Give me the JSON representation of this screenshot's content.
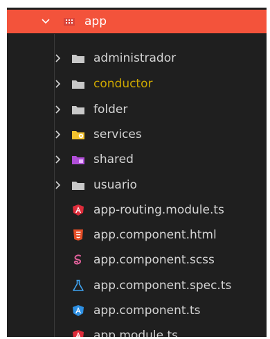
{
  "explorer": {
    "root": {
      "label": "app",
      "icon": "folder-app-icon",
      "expanded": true
    },
    "folders": [
      {
        "label": "administrador",
        "icon": "folder-icon"
      },
      {
        "label": "conductor",
        "icon": "folder-icon",
        "color": "#cca700"
      },
      {
        "label": "folder",
        "icon": "folder-icon"
      },
      {
        "label": "services",
        "icon": "folder-services-icon"
      },
      {
        "label": "shared",
        "icon": "folder-shared-icon"
      },
      {
        "label": "usuario",
        "icon": "folder-icon"
      }
    ],
    "files": [
      {
        "label": "app-routing.module.ts",
        "icon": "angular-icon"
      },
      {
        "label": "app.component.html",
        "icon": "html-icon"
      },
      {
        "label": "app.component.scss",
        "icon": "sass-icon"
      },
      {
        "label": "app.component.spec.ts",
        "icon": "test-flask-icon"
      },
      {
        "label": "app.component.ts",
        "icon": "angular-component-icon"
      },
      {
        "label": "app.module.ts",
        "icon": "angular-icon"
      }
    ]
  },
  "colors": {
    "root_bg": "#f3533b",
    "panel_bg": "#1f1f1f",
    "text": "#d4d4d4",
    "accent_text": "#cca700"
  }
}
